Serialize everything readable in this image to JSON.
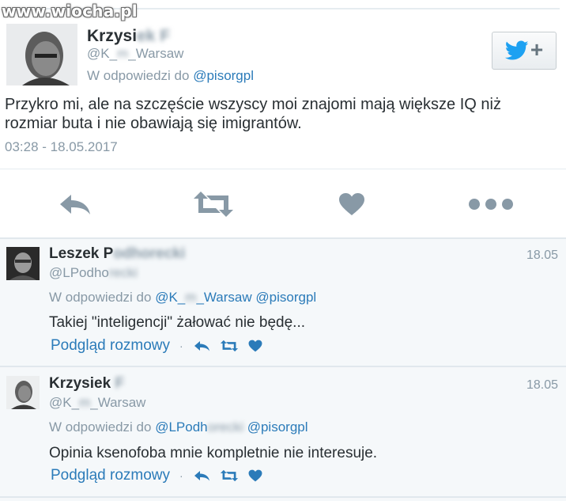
{
  "watermark": "www.wiocha.pl",
  "main": {
    "author_name": "Krzysi",
    "author_name_hidden": "ek F",
    "handle_start": "@K_",
    "handle_hidden": "m",
    "handle_end": "_Warsaw",
    "reply_prefix": "W odpowiedzi do",
    "reply_to": "@pisorgpl",
    "text": "Przykro mi, ale na szczęście wszyscy moi znajomi mają większe IQ niż rozmiar buta i nie obawiają się imigrantów.",
    "timestamp": "03:28 - 18.05.2017",
    "follow_plus": "+",
    "icons": [
      "twitter-bird-icon",
      "reply-icon",
      "retweet-icon",
      "like-icon",
      "more-icon"
    ]
  },
  "replies": [
    {
      "name": "Leszek P",
      "name_hidden": "odhorecki",
      "handle_start": "@LPodho",
      "handle_hidden": "recki",
      "handle_end": "",
      "date": "18.05",
      "reply_prefix": "W odpowiedzi do",
      "reply_to_1_start": "@K_",
      "reply_to_1_hidden": "m",
      "reply_to_1_end": "_Warsaw",
      "reply_to_2": "@pisorgpl",
      "text": "Takiej \"inteligencji\" żałować nie będę...",
      "conversation": "Podgląd rozmowy",
      "separator": "·"
    },
    {
      "name": "Krzysiek",
      "name_hidden": "F",
      "handle_start": "@K_",
      "handle_hidden": "m",
      "handle_end": "_Warsaw",
      "date": "18.05",
      "reply_prefix": "W odpowiedzi do",
      "reply_to_1_start": "@LPodh",
      "reply_to_1_hidden": "orecki",
      "reply_to_1_end": "",
      "reply_to_2": "@pisorgpl",
      "text": "Opinia ksenofoba mnie kompletnie nie interesuje.",
      "conversation": "Podgląd rozmowy",
      "separator": "·"
    }
  ],
  "colors": {
    "link": "#2b7bb9",
    "muted": "#8899a6",
    "text": "#292f33",
    "twitter_blue": "#1da1f2",
    "icon_gray": "#8899a6",
    "reply_bg": "#f5f8fa"
  }
}
